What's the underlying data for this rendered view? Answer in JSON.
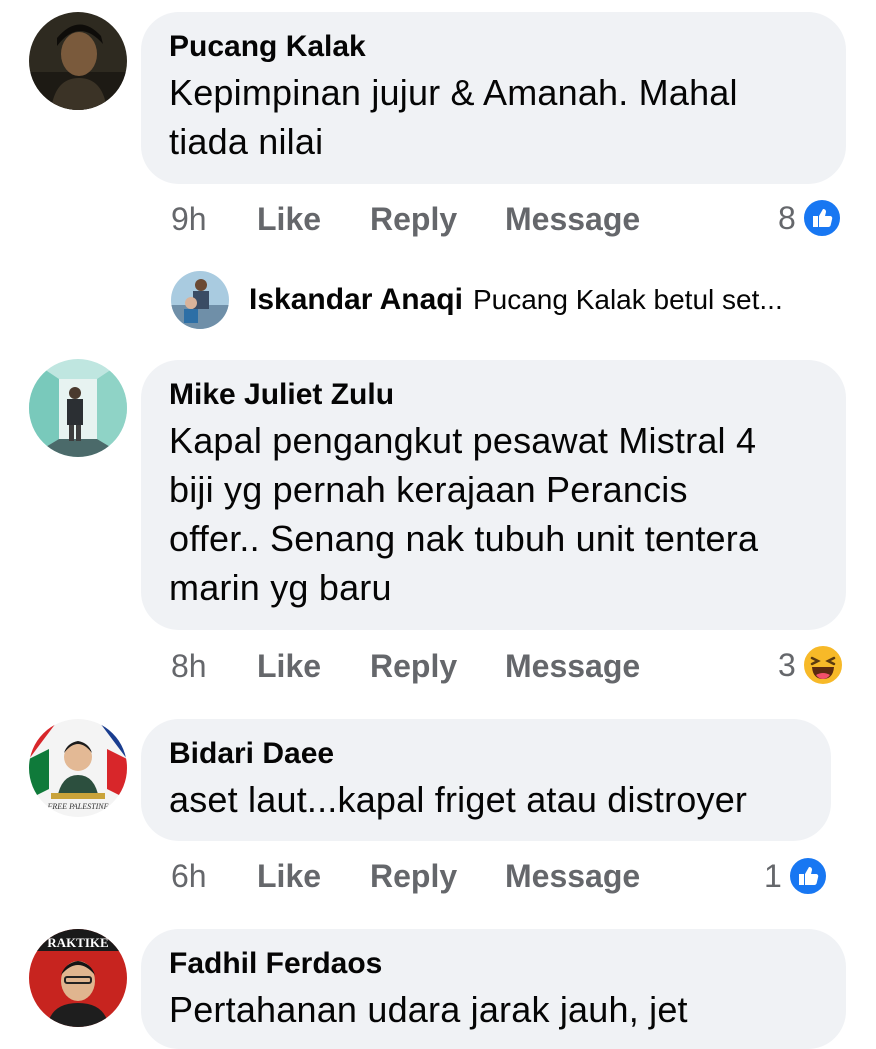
{
  "comments": [
    {
      "author": "Pucang Kalak",
      "text_lines": [
        "Kepimpinan jujur & Amanah. Mahal",
        "tiada nilai"
      ],
      "time": "9h",
      "like_label": "Like",
      "reply_label": "Reply",
      "message_label": "Message",
      "reaction_count": "8",
      "reaction_icon": "like-icon"
    },
    {
      "author": "Mike Juliet Zulu",
      "text_lines": [
        "Kapal pengangkut pesawat Mistral 4",
        "biji yg pernah kerajaan Perancis",
        "offer.. Senang nak tubuh unit tentera",
        "marin yg baru"
      ],
      "time": "8h",
      "like_label": "Like",
      "reply_label": "Reply",
      "message_label": "Message",
      "reaction_count": "3",
      "reaction_icon": "haha-icon"
    },
    {
      "author": "Bidari Daee",
      "text_lines": [
        "aset laut...kapal friget atau distroyer"
      ],
      "time": "6h",
      "like_label": "Like",
      "reply_label": "Reply",
      "message_label": "Message",
      "reaction_count": "1",
      "reaction_icon": "like-icon"
    },
    {
      "author": "Fadhil Ferdaos",
      "text_lines": [
        "Pertahanan udara jarak jauh, jet"
      ]
    }
  ],
  "reply_preview": {
    "author": "Iskandar Anaqi",
    "text": "Pucang Kalak betul set..."
  },
  "avatar_texts": {
    "free_palestine": "FREE PALESTINE",
    "banner": "RAKTIKE"
  },
  "colors": {
    "bubble": "#f0f2f5",
    "secondary_text": "#65676b",
    "like_blue": "#1877f2",
    "haha_yellow": "#f7b928"
  }
}
